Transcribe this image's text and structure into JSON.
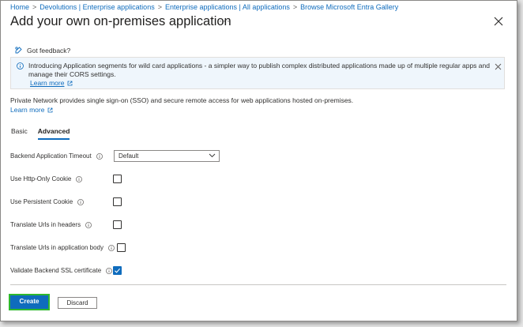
{
  "breadcrumb": {
    "items": [
      "Home",
      "Devolutions | Enterprise applications",
      "Enterprise applications | All applications",
      "Browse Microsoft Entra Gallery"
    ],
    "separator": ">"
  },
  "page": {
    "title": "Add your own on-premises application",
    "more": "···"
  },
  "feedback": {
    "label": "Got feedback?"
  },
  "banner": {
    "text": "Introducing Application segments for wild card applications - a simpler way to publish complex distributed applications made up of multiple regular apps and manage their CORS settings.",
    "learn_more": "Learn more"
  },
  "description": {
    "text": "Private Network provides single sign-on (SSO) and secure remote access for web applications hosted on-premises.",
    "learn_more": "Learn more"
  },
  "tabs": [
    {
      "label": "Basic",
      "active": false
    },
    {
      "label": "Advanced",
      "active": true
    }
  ],
  "form": {
    "timeout_label": "Backend Application Timeout",
    "timeout_value": "Default",
    "fields": [
      {
        "label": "Use Http-Only Cookie",
        "checked": false
      },
      {
        "label": "Use Persistent Cookie",
        "checked": false
      },
      {
        "label": "Translate Urls in headers",
        "checked": false
      },
      {
        "label": "Translate Urls in application body",
        "checked": false
      },
      {
        "label": "Validate Backend SSL certificate",
        "checked": true
      }
    ]
  },
  "footer": {
    "create_label": "Create",
    "discard_label": "Discard"
  },
  "colors": {
    "accent": "#0f6cbd",
    "banner_bg": "#eff6fc",
    "focus_outline": "#2eb82e"
  }
}
